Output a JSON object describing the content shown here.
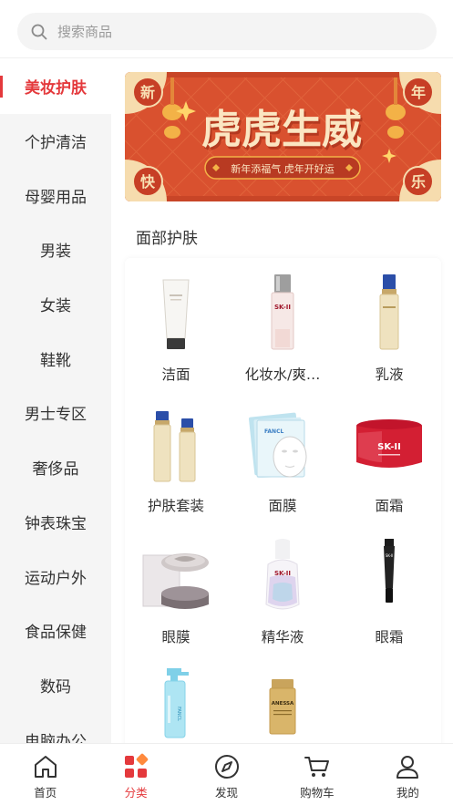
{
  "search": {
    "placeholder": "搜索商品"
  },
  "sidebar": {
    "items": [
      {
        "label": "美妆护肤",
        "active": true
      },
      {
        "label": "个护清洁"
      },
      {
        "label": "母婴用品"
      },
      {
        "label": "男装"
      },
      {
        "label": "女装"
      },
      {
        "label": "鞋靴"
      },
      {
        "label": "男士专区"
      },
      {
        "label": "奢侈品"
      },
      {
        "label": "钟表珠宝"
      },
      {
        "label": "运动户外"
      },
      {
        "label": "食品保健"
      },
      {
        "label": "数码"
      },
      {
        "label": "电脑办公"
      }
    ]
  },
  "banner": {
    "title": "虎虎生威",
    "subtitle": "新年添福气 虎年开好运",
    "corner_tl": "新",
    "corner_tr": "年",
    "corner_bl": "快",
    "corner_br": "乐"
  },
  "section": {
    "title": "面部护肤",
    "items": [
      {
        "label": "洁面",
        "icon": "cleanser-tube"
      },
      {
        "label": "化妆水/爽…",
        "icon": "toner-bottle"
      },
      {
        "label": "乳液",
        "icon": "lotion-bottle"
      },
      {
        "label": "护肤套装",
        "icon": "skincare-set"
      },
      {
        "label": "面膜",
        "icon": "face-mask"
      },
      {
        "label": "面霜",
        "icon": "cream-jar"
      },
      {
        "label": "眼膜",
        "icon": "eye-mask-jar"
      },
      {
        "label": "精华液",
        "icon": "serum-bottle"
      },
      {
        "label": "眼霜",
        "icon": "eye-cream-tube"
      },
      {
        "label": "",
        "icon": "cleansing-oil-bottle"
      },
      {
        "label": "",
        "icon": "sunscreen-bottle"
      }
    ]
  },
  "tabbar": {
    "items": [
      {
        "label": "首页",
        "icon": "home-icon"
      },
      {
        "label": "分类",
        "icon": "category-icon",
        "active": true
      },
      {
        "label": "发现",
        "icon": "compass-icon"
      },
      {
        "label": "购物车",
        "icon": "cart-icon"
      },
      {
        "label": "我的",
        "icon": "user-icon"
      }
    ]
  },
  "colors": {
    "accent": "#e4393c",
    "banner_bg": "#d9512f",
    "sidebar_bg": "#f5f5f5"
  }
}
